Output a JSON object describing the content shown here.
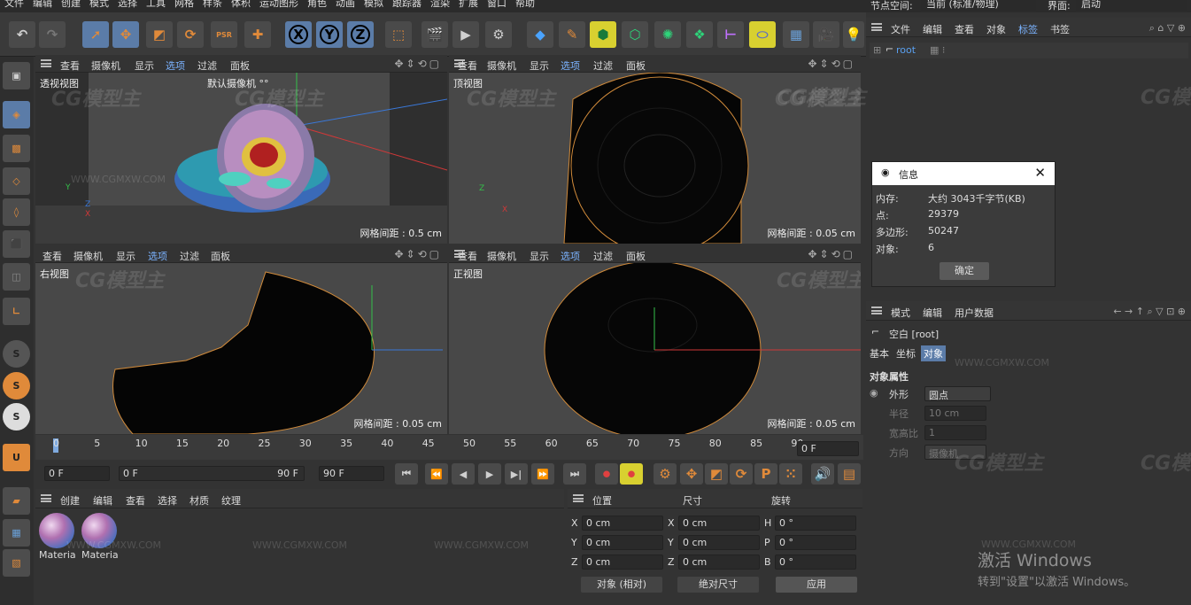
{
  "menu": [
    "文件",
    "编辑",
    "创建",
    "模式",
    "选择",
    "工具",
    "网格",
    "样条",
    "体积",
    "运动图形",
    "角色",
    "动画",
    "模拟",
    "跟踪器",
    "渲染",
    "扩展",
    "窗口",
    "帮助"
  ],
  "node_space_label": "节点空间:",
  "node_space_value": "当前 (标准/物理)",
  "layout_label": "界面:",
  "layout_value": "启动",
  "toolbar": {
    "x": "X",
    "y": "Y",
    "z": "Z",
    "psr": "PSR"
  },
  "vp_menu": [
    "查看",
    "摄像机",
    "显示",
    "选项",
    "过滤",
    "面板"
  ],
  "viewports": [
    {
      "name": "透视视图",
      "camera": "默认摄像机 °°",
      "grid": "网格间距 : 0.5 cm"
    },
    {
      "name": "顶视图",
      "grid": "网格间距 : 0.05 cm"
    },
    {
      "name": "右视图",
      "grid": "网格间距 : 0.05 cm"
    },
    {
      "name": "正视图",
      "grid": "网格间距 : 0.05 cm"
    }
  ],
  "axes": {
    "x": "X",
    "y": "Y",
    "z": "Z"
  },
  "object_manager": {
    "menu": [
      "文件",
      "编辑",
      "查看",
      "对象",
      "标签",
      "书签"
    ],
    "root": "root"
  },
  "info_dialog": {
    "title": "信息",
    "rows": [
      {
        "k": "内存:",
        "v": "大约 3043千字节(KB)"
      },
      {
        "k": "点:",
        "v": "29379"
      },
      {
        "k": "多边形:",
        "v": "50247"
      },
      {
        "k": "对象:",
        "v": "6"
      }
    ],
    "ok": "确定"
  },
  "attr": {
    "menu": [
      "模式",
      "编辑",
      "用户数据"
    ],
    "object": "空白 [root]",
    "tabs": [
      "基本",
      "坐标",
      "对象"
    ],
    "section": "对象属性",
    "display_label": "外形",
    "display_value": "圆点",
    "radius_label": "半径",
    "radius_value": "10 cm",
    "aspect_label": "宽高比",
    "aspect_value": "1",
    "orientation_label": "方向",
    "orientation_value": "摄像机"
  },
  "timeline": {
    "ticks": [
      "0",
      "5",
      "10",
      "15",
      "20",
      "25",
      "30",
      "35",
      "40",
      "45",
      "50",
      "55",
      "60",
      "65",
      "70",
      "75",
      "80",
      "85",
      "90"
    ],
    "current": "0 F",
    "start": "0 F",
    "start2": "0 F",
    "end": "90 F",
    "end2": "90 F"
  },
  "material": {
    "menu": [
      "创建",
      "编辑",
      "查看",
      "选择",
      "材质",
      "纹理"
    ],
    "items": [
      "Materia",
      "Materia"
    ]
  },
  "coords": {
    "headers": [
      "位置",
      "尺寸",
      "旋转"
    ],
    "rows": [
      {
        "a": "X",
        "av": "0 cm",
        "b": "X",
        "bv": "0 cm",
        "c": "H",
        "cv": "0 °"
      },
      {
        "a": "Y",
        "av": "0 cm",
        "b": "Y",
        "bv": "0 cm",
        "c": "P",
        "cv": "0 °"
      },
      {
        "a": "Z",
        "av": "0 cm",
        "b": "Z",
        "bv": "0 cm",
        "c": "B",
        "cv": "0 °"
      }
    ],
    "mode": "对象 (相对)",
    "size": "绝对尺寸",
    "apply": "应用"
  },
  "watermark": "CG模型主",
  "watermark_url": "WWW.CGMXW.COM",
  "activation": {
    "title": "激活 Windows",
    "sub": "转到\"设置\"以激活 Windows。"
  },
  "colors": {
    "accent": "#5b7ca8",
    "select": "#e08a3a",
    "highlight": "#d8d030"
  }
}
